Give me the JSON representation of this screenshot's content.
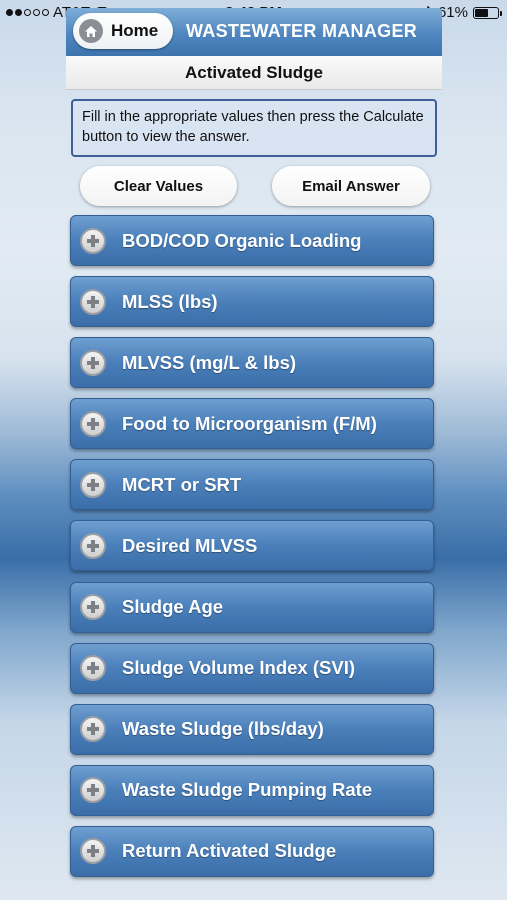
{
  "status_bar": {
    "carrier": "AT&T",
    "time": "3:42 PM",
    "battery_percent": "61%",
    "battery_level": 0.61,
    "signal_bars_filled": 2,
    "signal_bars_total": 5
  },
  "nav": {
    "home_label": "Home",
    "title": "WASTEWATER MANAGER",
    "subtitle": "Activated Sludge"
  },
  "instructions": "Fill in the appropriate values then press the Calculate button to view the answer.",
  "actions": {
    "clear_label": "Clear Values",
    "email_label": "Email Answer"
  },
  "menu": {
    "items": [
      {
        "label": "BOD/COD Organic Loading"
      },
      {
        "label": "MLSS (lbs)"
      },
      {
        "label": "MLVSS (mg/L & lbs)"
      },
      {
        "label": "Food to Microorganism (F/M)"
      },
      {
        "label": "MCRT or SRT"
      },
      {
        "label": "Desired MLVSS"
      },
      {
        "label": "Sludge Age"
      },
      {
        "label": "Sludge Volume Index (SVI)"
      },
      {
        "label": "Waste Sludge (lbs/day)"
      },
      {
        "label": "Waste Sludge Pumping Rate"
      },
      {
        "label": "Return Activated Sludge"
      }
    ],
    "icon": "plus-circle-icon"
  },
  "colors": {
    "nav_blue": "#4f86bf",
    "menu_blue": "#4a7fba",
    "instruction_bg": "#d9e4f3",
    "instruction_border": "#3f5f99"
  }
}
